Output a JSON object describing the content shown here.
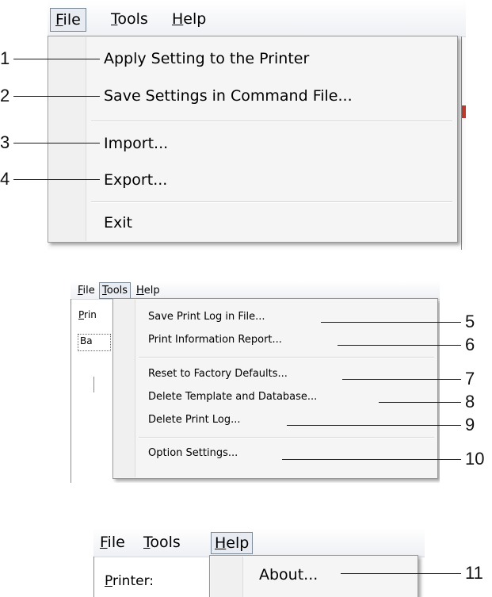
{
  "panel1": {
    "menubar": [
      {
        "pre": "",
        "u": "F",
        "post": "ile"
      },
      {
        "pre": "",
        "u": "T",
        "post": "ools"
      },
      {
        "pre": "",
        "u": "H",
        "post": "elp"
      }
    ],
    "items": [
      "Apply Setting to the Printer",
      "Save Settings in Command File...",
      "Import...",
      "Export...",
      "Exit"
    ],
    "callouts": [
      "1",
      "2",
      "3",
      "4"
    ]
  },
  "panel2": {
    "menubar": [
      {
        "pre": "",
        "u": "F",
        "post": "ile"
      },
      {
        "pre": "",
        "u": "T",
        "post": "ools"
      },
      {
        "pre": "",
        "u": "H",
        "post": "elp"
      }
    ],
    "background_text": {
      "prin_u": "P",
      "prin_rest": "rin",
      "ba": "Ba"
    },
    "items": [
      "Save Print Log in File...",
      "Print Information Report...",
      "Reset to Factory Defaults...",
      "Delete Template and Database...",
      "Delete Print Log...",
      "Option Settings..."
    ],
    "callouts": [
      "5",
      "6",
      "7",
      "8",
      "9",
      "10"
    ]
  },
  "panel3": {
    "menubar": [
      {
        "pre": "",
        "u": "F",
        "post": "ile"
      },
      {
        "pre": "",
        "u": "T",
        "post": "ools"
      },
      {
        "pre": "",
        "u": "H",
        "post": "elp"
      }
    ],
    "printer_label": {
      "u": "P",
      "rest": "rinter:"
    },
    "items": [
      "About..."
    ],
    "callouts": [
      "11"
    ]
  }
}
